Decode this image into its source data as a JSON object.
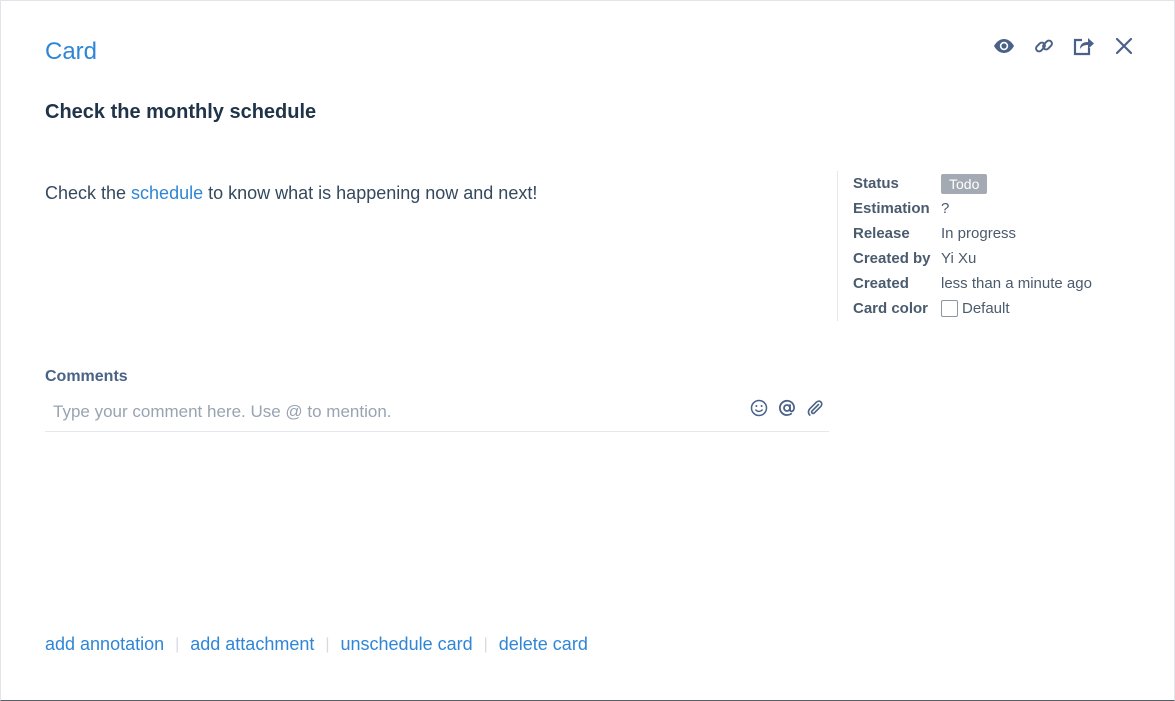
{
  "header": {
    "title": "Card",
    "actions": [
      {
        "name": "watch",
        "icon": "eye-icon"
      },
      {
        "name": "link",
        "icon": "link-icon"
      },
      {
        "name": "share",
        "icon": "share-icon"
      },
      {
        "name": "close",
        "icon": "close-icon"
      }
    ]
  },
  "card": {
    "heading": "Check the monthly schedule",
    "description": {
      "before": "Check the ",
      "link": "schedule",
      "after": " to know what is happening now and next!"
    }
  },
  "meta": {
    "status_label": "Status",
    "status_value": "Todo",
    "estimation_label": "Estimation",
    "estimation_value": "?",
    "release_label": "Release",
    "release_value": "In progress",
    "created_by_label": "Created by",
    "created_by_value": "Yi Xu",
    "created_label": "Created",
    "created_value": "less than a minute ago",
    "card_color_label": "Card color",
    "card_color_value": "Default"
  },
  "comments": {
    "label": "Comments",
    "placeholder": "Type your comment here. Use @ to mention.",
    "value": "",
    "tools": [
      "emoji-icon",
      "mention-icon",
      "attachment-icon"
    ]
  },
  "footer": {
    "add_annotation": "add annotation",
    "add_attachment": "add attachment",
    "unschedule_card": "unschedule card",
    "delete_card": "delete card",
    "separator": "|"
  },
  "colors": {
    "accent": "#2f86d6",
    "icon": "#4a6288",
    "status_badge": "#a3aab4",
    "heading": "#1f3349"
  }
}
